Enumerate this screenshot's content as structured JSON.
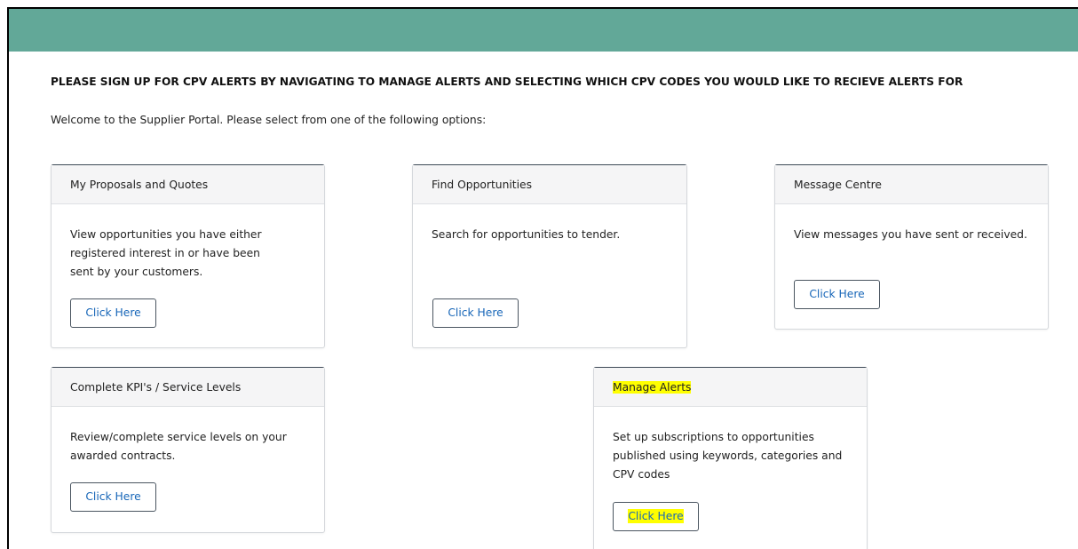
{
  "notice": "PLEASE SIGN UP FOR CPV ALERTS BY NAVIGATING TO MANAGE ALERTS AND SELECTING WHICH CPV CODES YOU WOULD LIKE TO RECIEVE ALERTS FOR",
  "welcome": "Welcome to the Supplier Portal. Please select from one of the following options:",
  "colors": {
    "topbar": "#62a898",
    "highlight": "#ffff00",
    "button_text": "#1766b8"
  },
  "cards": {
    "proposals": {
      "title": "My Proposals and Quotes",
      "description": "View opportunities you have either registered interest in or have been sent by your customers.",
      "button": "Click Here"
    },
    "opportunities": {
      "title": "Find Opportunities",
      "description": "Search for opportunities to tender.",
      "button": "Click Here"
    },
    "messages": {
      "title": "Message Centre",
      "description": "View messages you have sent or received.",
      "button": "Click Here"
    },
    "kpis": {
      "title": "Complete KPI's / Service Levels",
      "description": "Review/complete service levels on your awarded contracts.",
      "button": "Click Here"
    },
    "alerts": {
      "title": "Manage Alerts",
      "description": "Set up subscriptions to opportunities published using keywords, categories and CPV codes",
      "button": "Click Here"
    }
  }
}
